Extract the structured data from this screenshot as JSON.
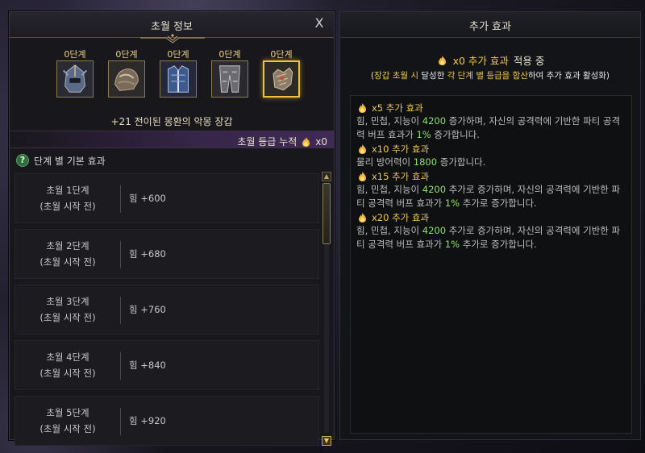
{
  "left_panel": {
    "title": "초월 정보",
    "close_label": "X",
    "stages": [
      {
        "label": "0단계",
        "icon": "helmet-icon"
      },
      {
        "label": "0단계",
        "icon": "shoulder-armor-icon"
      },
      {
        "label": "0단계",
        "icon": "chest-armor-icon"
      },
      {
        "label": "0단계",
        "icon": "leg-armor-icon"
      },
      {
        "label": "0단계",
        "icon": "gloves-icon"
      }
    ],
    "item_name": "+21 전이된 몽환의 악몽 장갑",
    "accum_label": "초월 등급 누적",
    "accum_value": "x0",
    "section_title": "단계 별 기본 효과",
    "help_glyph": "?",
    "rows": [
      {
        "stage": "초월 1단계",
        "note": "(초월 시작 전)",
        "value": "힘 +600"
      },
      {
        "stage": "초월 2단계",
        "note": "(초월 시작 전)",
        "value": "힘 +680"
      },
      {
        "stage": "초월 3단계",
        "note": "(초월 시작 전)",
        "value": "힘 +760"
      },
      {
        "stage": "초월 4단계",
        "note": "(초월 시작 전)",
        "value": "힘 +840"
      },
      {
        "stage": "초월 5단계",
        "note": "(초월 시작 전)",
        "value": "힘 +920"
      }
    ],
    "scroll_position": 0.0
  },
  "right_panel": {
    "title": "추가 효과",
    "status": {
      "prefix": "x0 추가 효과",
      "suffix": "적용 중"
    },
    "note": {
      "p1": "(",
      "p2": "장갑 초월 시",
      "p3": " 달성한 ",
      "p4": "각 단계 별 등급을 합산",
      "p5": "하여 추가 효과 활성화)"
    },
    "effects": [
      {
        "title": "x5 추가 효과",
        "t1": "힘, 민첩, 지능이 ",
        "v1": "4200",
        "t2": " 증가하며, 자신의 공격력에 기반한 파티 공격력 버프 효과가 ",
        "v2": "1%",
        "t3": " 증가합니다."
      },
      {
        "title": "x10 추가 효과",
        "t1": "물리 방어력이 ",
        "v1": "1800",
        "t2": " 증가합니다.",
        "v2": "",
        "t3": ""
      },
      {
        "title": "x15 추가 효과",
        "t1": "힘, 민첩, 지능이 ",
        "v1": "4200",
        "t2": " 추가로 증가하며, 자신의 공격력에 기반한 파티 공격력 버프 효과가 ",
        "v2": "1%",
        "t3": " 추가로 증가합니다."
      },
      {
        "title": "x20 추가 효과",
        "t1": "힘, 민첩, 지능이 ",
        "v1": "4200",
        "t2": " 추가로 증가하며, 자신의 공격력에 기반한 파티 공격력 버프 효과가 ",
        "v2": "1%",
        "t3": " 추가로 증가합니다."
      }
    ]
  },
  "colors": {
    "gold": "#f2c84a",
    "green": "#8ee06a",
    "frame": "#8a7a55"
  }
}
